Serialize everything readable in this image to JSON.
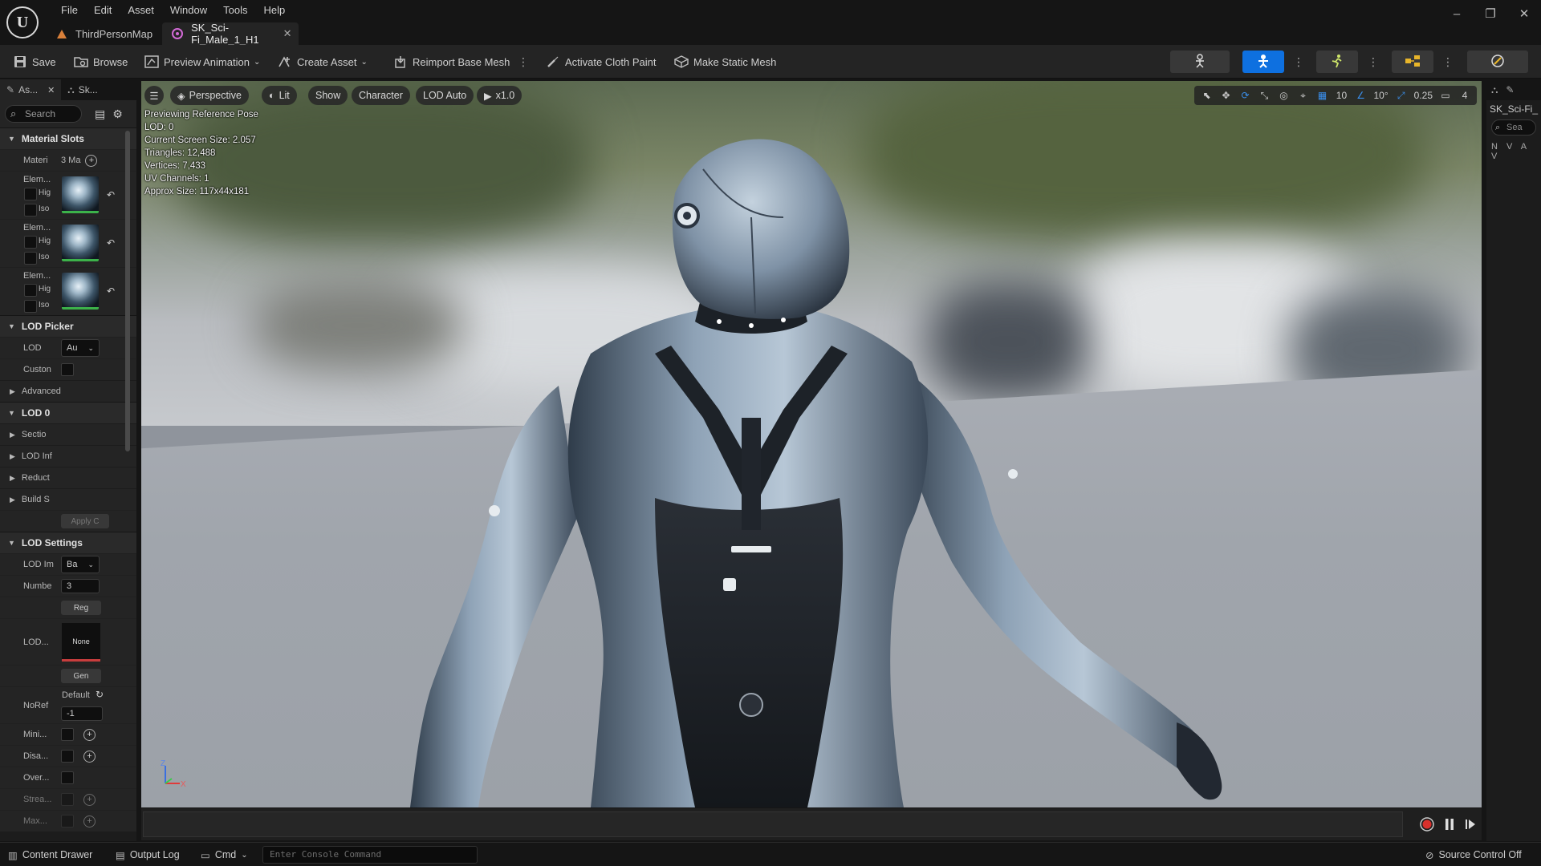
{
  "menu": [
    "File",
    "Edit",
    "Asset",
    "Window",
    "Tools",
    "Help"
  ],
  "tabs": [
    {
      "label": "ThirdPersonMap",
      "close": ""
    },
    {
      "label": "SK_Sci-Fi_Male_1_H1",
      "close": "✕"
    }
  ],
  "window_controls": {
    "minimize": "–",
    "maximize": "❐",
    "close": "✕"
  },
  "toolbar": {
    "save": "Save",
    "browse": "Browse",
    "preview_animation": "Preview Animation",
    "create_asset": "Create Asset",
    "reimport": "Reimport Base Mesh",
    "activate_cloth": "Activate Cloth Paint",
    "make_static": "Make Static Mesh"
  },
  "left_panel": {
    "tab1": "As...",
    "tab1_close": "✕",
    "tab2": "Sk...",
    "search_placeholder": "Search",
    "material_slots": {
      "header": "Material Slots",
      "materials_label": "Materi",
      "materials_value": "3 Ma",
      "elements": [
        {
          "label": "Elem...",
          "hig": "Hig",
          "iso": "Iso"
        },
        {
          "label": "Elem...",
          "hig": "Hig",
          "iso": "Iso"
        },
        {
          "label": "Elem...",
          "hig": "Hig",
          "iso": "Iso"
        }
      ]
    },
    "lod_picker": {
      "header": "LOD Picker",
      "lod_label": "LOD",
      "lod_value": "Au",
      "custom_label": "Custon"
    },
    "advanced": "Advanced",
    "lod0": {
      "header": "LOD 0",
      "items": [
        "Sectio",
        "LOD Inf",
        "Reduct",
        "Build S"
      ],
      "apply": "Apply C"
    },
    "lod_settings": {
      "header": "LOD Settings",
      "lod_import_label": "LOD Im",
      "lod_import_value": "Ba",
      "number_label": "Numbe",
      "number_value": "3",
      "regen_button": "Reg",
      "lod_asset_label": "LOD...",
      "lod_asset_value": "None",
      "gen_button": "Gen",
      "noref_label": "NoRef",
      "noref_value": "Default",
      "noref_number": "-1",
      "mini_label": "Mini...",
      "disa_label": "Disa...",
      "over_label": "Over...",
      "strea_label": "Strea...",
      "max_label": "Max..."
    }
  },
  "viewport": {
    "menu_icon": "☰",
    "perspective": "Perspective",
    "lit": "Lit",
    "show": "Show",
    "character": "Character",
    "lod_auto": "LOD Auto",
    "speed": "x1.0",
    "stats": [
      "Previewing Reference Pose",
      "LOD: 0",
      "Current Screen Size: 2.057",
      "Triangles: 12,488",
      "Vertices: 7,433",
      "UV Channels: 1",
      "Approx Size: 117x44x181"
    ],
    "grid_snap": "10",
    "rotation_snap": "10°",
    "scale_snap": "0.25",
    "camera_speed": "4",
    "axis_z": "Z",
    "axis_x": "X"
  },
  "right_panel": {
    "title": "SK_Sci-Fi_",
    "search_placeholder": "Sea",
    "cols": "N V A V"
  },
  "statusbar": {
    "content_drawer": "Content Drawer",
    "output_log": "Output Log",
    "cmd": "Cmd",
    "console_placeholder": "Enter Console Command",
    "source_control": "Source Control Off"
  },
  "colors": {
    "accent": "#0e70e0",
    "record": "#d9302c",
    "material_ok": "#3cb24a"
  }
}
